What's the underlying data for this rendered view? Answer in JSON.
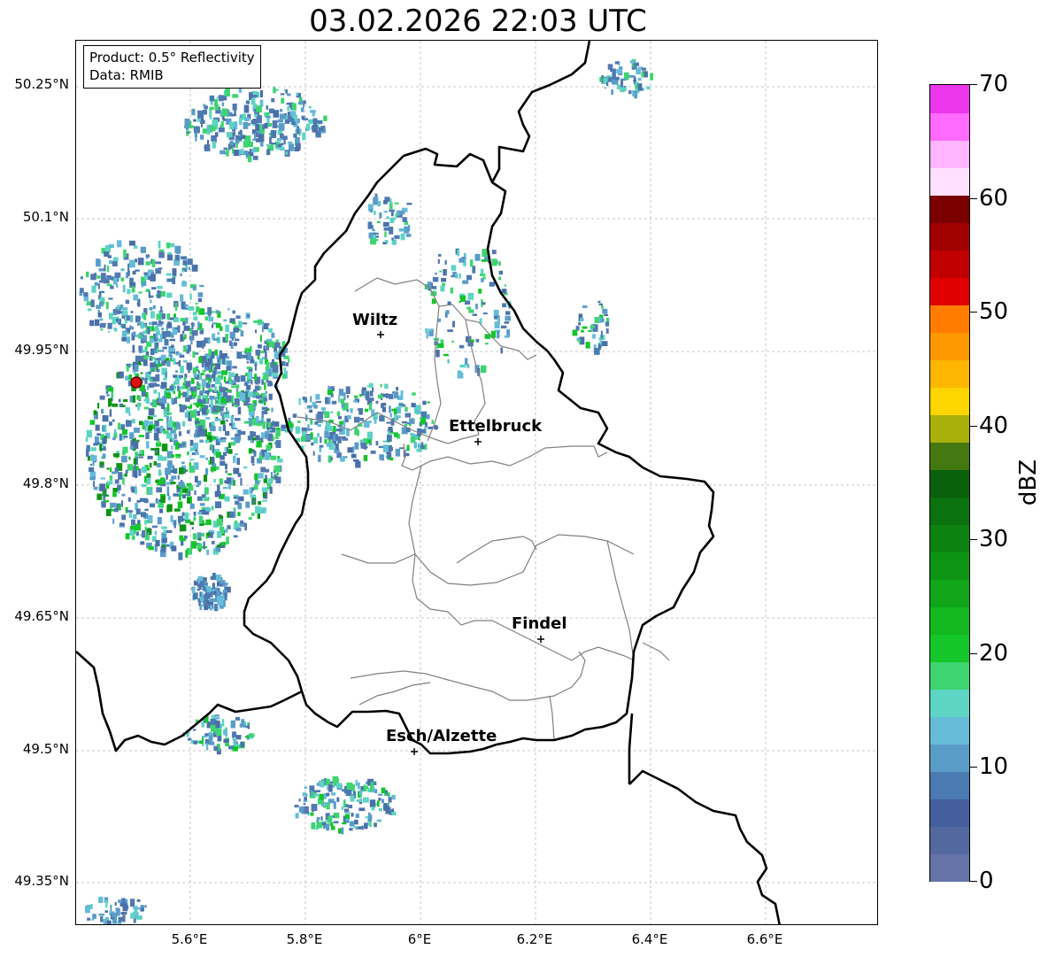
{
  "title": "03.02.2026 22:03 UTC",
  "product_box": {
    "product": "Product: 0.5° Reflectivity",
    "data": "Data: RMIB"
  },
  "latitude_labels": [
    "50.25°N",
    "50.1°N",
    "49.95°N",
    "49.8°N",
    "49.65°N",
    "49.5°N",
    "49.35°N"
  ],
  "longitude_labels": [
    "5.6°E",
    "5.8°E",
    "6°E",
    "6.2°E",
    "6.4°E",
    "6.6°E"
  ],
  "cities": [
    {
      "name": "Wiltz"
    },
    {
      "name": "Ettelbruck"
    },
    {
      "name": "Findel"
    },
    {
      "name": "Esch/Alzette"
    }
  ],
  "colorbar": {
    "label": "dBZ",
    "ticks": [
      "0",
      "10",
      "20",
      "30",
      "40",
      "50",
      "60",
      "70"
    ],
    "min": 0,
    "max": 70,
    "colors": [
      "#6473a8",
      "#5468a0",
      "#445e9e",
      "#4a7ab0",
      "#5a9cc8",
      "#65bcd8",
      "#5ed4c4",
      "#3ed470",
      "#14c62a",
      "#12b81e",
      "#10a618",
      "#0e9414",
      "#0c8210",
      "#0a720e",
      "#08600c",
      "#447810",
      "#aab00a",
      "#ffd500",
      "#ffb600",
      "#ff9800",
      "#ff7c00",
      "#e00000",
      "#c00000",
      "#a00000",
      "#7a0000",
      "#ffe1ff",
      "#ffb6ff",
      "#ff6aff",
      "#ec36ec"
    ]
  },
  "radar_marker_color": "#e01010"
}
